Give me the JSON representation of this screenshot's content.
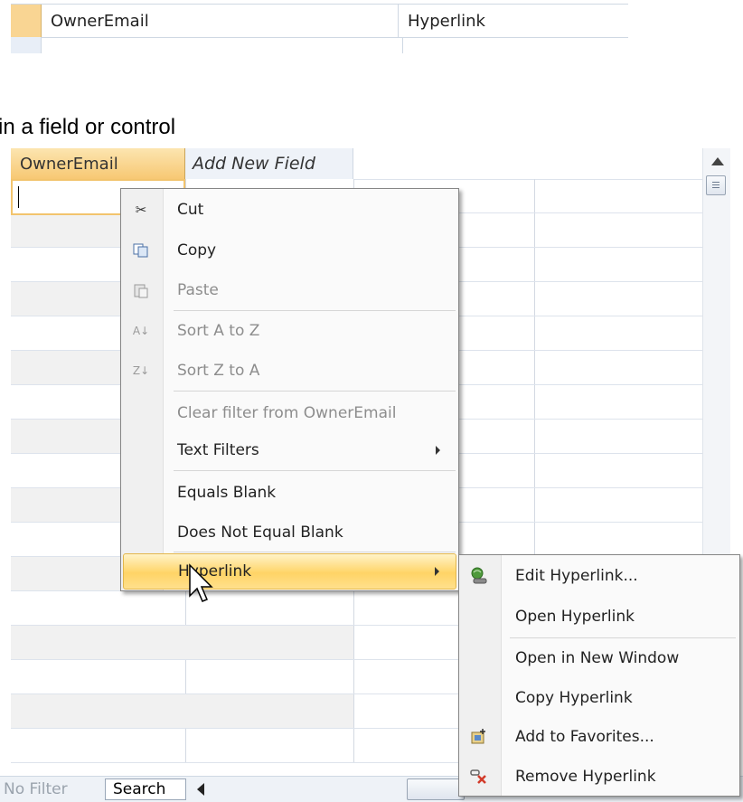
{
  "field_definition": {
    "name": "OwnerEmail",
    "type": "Hyperlink"
  },
  "caption": "in a field or control",
  "datasheet": {
    "column_headers": [
      "OwnerEmail",
      "Add New Field"
    ]
  },
  "context_menu": {
    "items": [
      {
        "label": "Cut",
        "icon": "scissors-icon",
        "enabled": true
      },
      {
        "label": "Copy",
        "icon": "copy-icon",
        "enabled": true
      },
      {
        "label": "Paste",
        "icon": "paste-icon",
        "enabled": false
      },
      {
        "label": "Sort A to Z",
        "icon": "sort-ascending-icon",
        "enabled": false
      },
      {
        "label": "Sort Z to A",
        "icon": "sort-descending-icon",
        "enabled": false
      },
      {
        "label": "Clear filter from OwnerEmail",
        "enabled": false
      },
      {
        "label": "Text Filters",
        "enabled": true,
        "submenu": true
      },
      {
        "label": "Equals Blank",
        "enabled": true
      },
      {
        "label": "Does Not Equal Blank",
        "enabled": true
      },
      {
        "label": "Hyperlink",
        "enabled": true,
        "submenu": true,
        "highlighted": true
      }
    ]
  },
  "hyperlink_submenu": {
    "items": [
      {
        "label": "Edit Hyperlink...",
        "icon": "edit-hyperlink-icon"
      },
      {
        "label": "Open Hyperlink"
      },
      {
        "label": "Open in New Window"
      },
      {
        "label": "Copy Hyperlink"
      },
      {
        "label": "Add to Favorites...",
        "icon": "add-favorites-icon"
      },
      {
        "label": "Remove Hyperlink",
        "icon": "remove-hyperlink-icon"
      }
    ]
  },
  "status_bar": {
    "filter_label": "No Filter",
    "search_label": "Search"
  }
}
